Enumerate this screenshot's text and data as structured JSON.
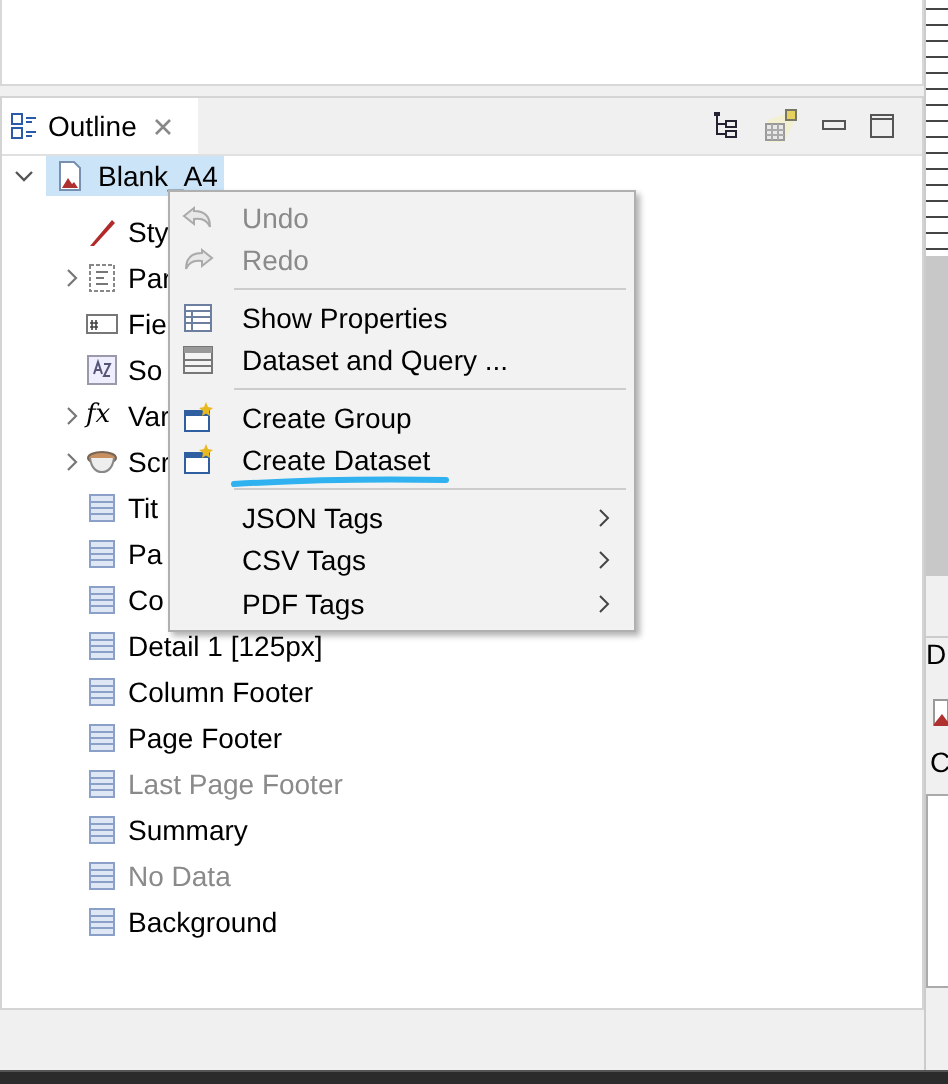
{
  "outline": {
    "tab": {
      "label": "Outline",
      "selected": true
    },
    "tree": [
      {
        "label": "Blank_A4",
        "kind": "report",
        "expanded": true,
        "selected": true,
        "disabled": false,
        "children": [
          {
            "label": "Sty",
            "kind": "style",
            "disabled": false
          },
          {
            "label": "Par",
            "kind": "parameters",
            "expanded": false,
            "disabled": false
          },
          {
            "label": "Fie",
            "kind": "fields",
            "disabled": false
          },
          {
            "label": "So",
            "kind": "sort",
            "disabled": false
          },
          {
            "label": "Var",
            "kind": "variables",
            "icon_text": "fx",
            "expanded": false,
            "disabled": false
          },
          {
            "label": "Scr",
            "kind": "scriptlets",
            "expanded": false,
            "disabled": false
          },
          {
            "label": "Tit",
            "kind": "band",
            "disabled": false
          },
          {
            "label": "Pa",
            "kind": "band",
            "disabled": false
          },
          {
            "label": "Co",
            "kind": "band",
            "disabled": false
          },
          {
            "label": "Detail 1 [125px]",
            "kind": "band",
            "disabled": false
          },
          {
            "label": "Column Footer",
            "kind": "band",
            "disabled": false
          },
          {
            "label": "Page Footer",
            "kind": "band",
            "disabled": false
          },
          {
            "label": "Last Page Footer",
            "kind": "band",
            "disabled": true
          },
          {
            "label": "Summary",
            "kind": "band",
            "disabled": false
          },
          {
            "label": "No Data",
            "kind": "band",
            "disabled": true
          },
          {
            "label": "Background",
            "kind": "band",
            "disabled": false
          }
        ]
      }
    ]
  },
  "context_menu": [
    {
      "kind": "undo",
      "label": "Undo",
      "disabled": true
    },
    {
      "kind": "redo",
      "label": "Redo",
      "disabled": true
    },
    {
      "kind": "separator"
    },
    {
      "kind": "properties",
      "label": "Show Properties",
      "disabled": false
    },
    {
      "kind": "dataset",
      "label": "Dataset and Query ...",
      "disabled": false
    },
    {
      "kind": "separator"
    },
    {
      "kind": "create",
      "label": "Create Group",
      "disabled": false,
      "underlined": false
    },
    {
      "kind": "create",
      "label": "Create Dataset",
      "disabled": false,
      "underlined": true
    },
    {
      "kind": "separator"
    },
    {
      "kind": "plain",
      "label": "JSON Tags",
      "disabled": false,
      "submenu": true
    },
    {
      "kind": "plain",
      "label": "CSV Tags",
      "disabled": false,
      "submenu": true
    },
    {
      "kind": "plain",
      "label": "PDF Tags",
      "disabled": false,
      "submenu": true
    }
  ],
  "right_panel": {
    "tab_label": "D",
    "label": "C"
  }
}
